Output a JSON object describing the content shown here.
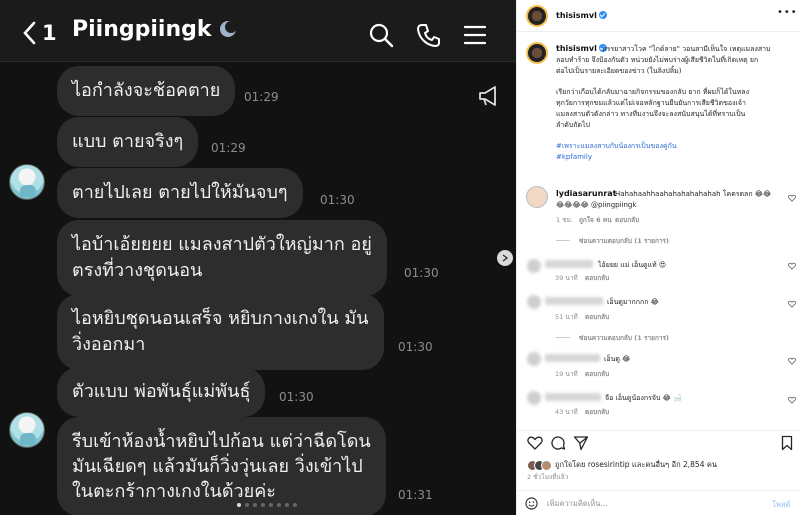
{
  "chat": {
    "back_count": "1",
    "contact_name": "Piingpiingk",
    "messages": [
      {
        "text": "ไอกำลังจะช้อคตาย",
        "time": "01:29"
      },
      {
        "text": "แบบ ตายจริงๆ",
        "time": "01:29"
      },
      {
        "text": "ตายไปเลย ตายไปให้มันจบๆ",
        "time": "01:30"
      },
      {
        "text": "ไอบ้าเอ้ยยยย แมลงสาปตัวใหญ่มาก อยู่\nตรงที่วางชุดนอน",
        "time": "01:30"
      },
      {
        "text": "ไอหยิบชุดนอนเสร็จ หยิบกางเกงใน มัน\nวิ่งออกมา",
        "time": "01:30"
      },
      {
        "text": "ตัวแบบ พ่อพันธุ์แม่พันธุ์",
        "time": "01:30"
      },
      {
        "text": "รีบเข้าห้องน้ำหยิบไปก้อน แต่ว่าฉีดโดน\nมันเฉียดๆ แล้วมันก็วิ่งวุ่นเลย วิ่งเข้าไป\nในตะกร้ากางเกงในด้วยค่ะ",
        "time": "01:31"
      }
    ]
  },
  "post": {
    "username": "thisismvl",
    "caption_line1": "ภรรยาสาวโวค \"ไกด์ลาย\" วอนสามีเห็นใจ เหตุแมลงสาบ",
    "caption_line2": "ลอบทำร้าย จึงป้องกันตัว หน่วยยังไม่พบร่างผู้เสียชีวิตในที่เกิดเหตุ ยก",
    "caption_line3": "ต่อไปเป็นรายละเอียดของข่าว (ในลิงปลิ้ม)",
    "caption_line4": "เรียกว่าเกือบได้กลับมาฉายกิจกรรมของกลับ ยาก ที่ผมก็ได้ในหลง",
    "caption_line5": "ทุกวัยการทุกขมแล้วแต่ไม่เจอหลักฐานยืนยันการเสียชีวิตของเจ้า",
    "caption_line6": "แมลงสาบตัวดังกล่าว ทางทีมงานจึงจะลงสนับสนุนได้ที่ทราบเป็น",
    "caption_line7": "ลำดับถัดไป",
    "hashtag1": "#เพราะแมลงสาบกับน้องกรเป็นของคู่กัน",
    "hashtag2": "#kpfamily",
    "comment_user": "lydiasarunrat",
    "comment_text": "Hahahaahhaahahahahahahah โคตรตลก 😂😂",
    "comment_text2": "😂😂😂😂 @piingpiingk",
    "comment_meta_time": "1 ชม.",
    "comment_meta_likes": "ถูกใจ 6 คน",
    "comment_meta_reply": "ตอบกลับ",
    "hide_replies": "ซ่อนความตอบกลับ (1 รายการ)",
    "replies": [
      {
        "text": "ไอ้ยยย แม่ เอ็นดูแท้ 😍",
        "time": "39 นาที",
        "reply": "ตอบกลับ"
      },
      {
        "text": "เอ็นดูมากกกก 😂",
        "time": "51 นาที",
        "reply": "ตอบกลับ"
      },
      {
        "text": "เอ็นดู 😂",
        "time": "19 นาที",
        "reply": "ตอบกลับ"
      },
      {
        "text": "จือ เอ็นดูน้องกรจับ 😂 🛁",
        "time": "43 นาที",
        "reply": "ตอบกลับ"
      }
    ],
    "hide_replies_2": "ซ่อนความตอบกลับ (1 รายการ)",
    "likes_text": "ถูกใจโดย rosesirintip และคนอื่นๆ อีก 2,854 คน",
    "posted_ago": "2 ชั่วโมงที่แล้ว",
    "comment_placeholder": "เพิ่มความคิดเห็น...",
    "post_label": "โพสต์"
  }
}
